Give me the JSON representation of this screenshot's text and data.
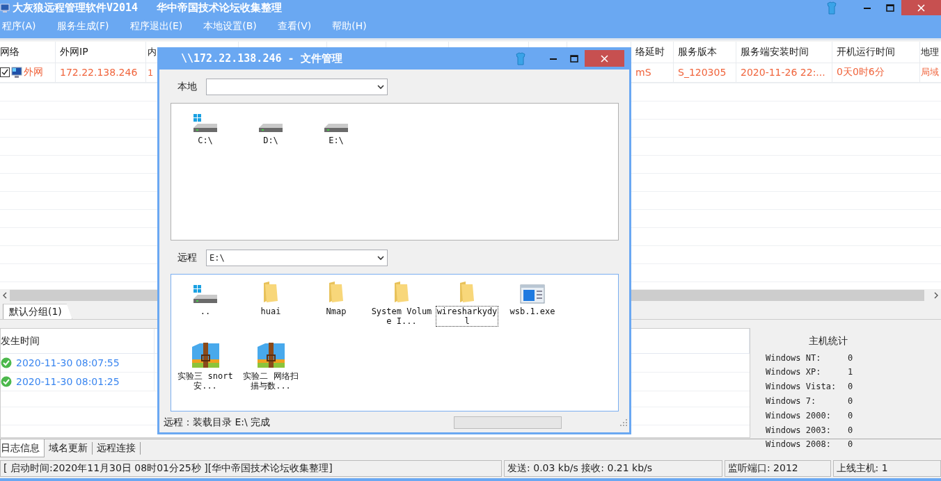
{
  "window": {
    "title": "大灰狼远程管理软件V2014   华中帝国技术论坛收集整理"
  },
  "menu": [
    "程序(A)",
    "服务生成(F)",
    "程序退出(E)",
    "本地设置(B)",
    "查看(V)",
    "帮助(H)"
  ],
  "hosts_table": {
    "columns": [
      "网络",
      "外网IP",
      "内",
      "络延时",
      "服务版本",
      "服务端安装时间",
      "开机运行时间",
      "地理"
    ],
    "rows": [
      {
        "checked": true,
        "cells": [
          "外网",
          "172.22.138.246",
          "1",
          "mS",
          "S_120305",
          "2020-11-26 22:...",
          "0天0时6分",
          "局域"
        ]
      }
    ]
  },
  "group_tabs": [
    {
      "label": "默认分组(1)",
      "selected": true
    }
  ],
  "log_table": {
    "columns": [
      "发生时间"
    ],
    "rows": [
      {
        "kind": "ok",
        "time": "2020-11-30 08:07:55"
      },
      {
        "kind": "ok",
        "time": "2020-11-30 08:01:25"
      }
    ]
  },
  "host_stats": {
    "title": "主机统计",
    "rows": [
      {
        "label": "Windows NT:",
        "value": "0"
      },
      {
        "label": "Windows XP:",
        "value": "1"
      },
      {
        "label": "Windows Vista:",
        "value": "0"
      },
      {
        "label": "Windows 7:",
        "value": "0"
      },
      {
        "label": "Windows 2000:",
        "value": "0"
      },
      {
        "label": "Windows 2003:",
        "value": "0"
      },
      {
        "label": "Windows 2008:",
        "value": "0"
      }
    ]
  },
  "bottom_tabs": [
    {
      "label": "日志信息",
      "selected": true
    },
    {
      "label": "域名更新",
      "selected": false
    },
    {
      "label": "远程连接",
      "selected": false
    }
  ],
  "status_bar": [
    "[ 启动时间:2020年11月30日 08时01分25秒 ][华中帝国技术论坛收集整理]",
    "发送: 0.03 kb/s 接收: 0.21 kb/s",
    "监听端口: 2012",
    "上线主机: 1"
  ],
  "file_manager": {
    "title": "\\\\172.22.138.246 - 文件管理",
    "local": {
      "label": "本地"
    },
    "local_items": [
      {
        "kind": "system_drive",
        "label": "C:\\",
        "selected": false
      },
      {
        "kind": "drive",
        "label": "D:\\",
        "selected": false
      },
      {
        "kind": "drive",
        "label": "E:\\",
        "selected": false
      }
    ],
    "remote": {
      "label": "远程",
      "value": "E:\\"
    },
    "remote_items": [
      {
        "kind": "system_drive",
        "label": "..",
        "selected": false
      },
      {
        "kind": "folder",
        "label": "huai",
        "selected": false
      },
      {
        "kind": "folder",
        "label": "Nmap",
        "selected": false
      },
      {
        "kind": "folder",
        "label": "System Volume I...",
        "selected": false
      },
      {
        "kind": "folder",
        "label": "wiresharkydyl",
        "selected": true
      },
      {
        "kind": "exe",
        "label": "wsb.1.exe",
        "selected": false
      },
      {
        "kind": "archive",
        "label": "实验三 snort安...",
        "selected": false
      },
      {
        "kind": "archive",
        "label": "实验二 网络扫描与数...",
        "selected": false
      }
    ],
    "status": "远程：装载目录 E:\\ 完成"
  }
}
